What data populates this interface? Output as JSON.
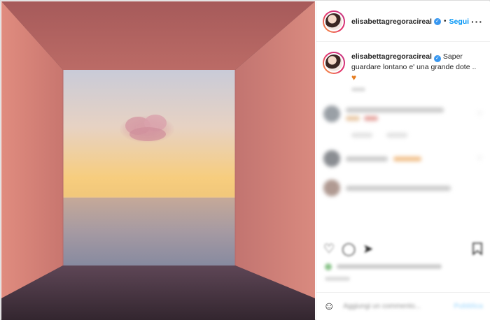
{
  "header": {
    "username": "elisabettagregoracireal",
    "follow_label": "Segui",
    "separator": "•",
    "more_icon": "more-options-icon"
  },
  "caption": {
    "username": "elisabettagregoracireal",
    "text": "Saper guardare lontano e' una grande dote ..",
    "emoji": "♥"
  },
  "actions": {
    "like_icon": "heart-outline-icon",
    "comment_icon": "comment-icon",
    "share_icon": "share-icon",
    "save_icon": "bookmark-icon"
  },
  "add_comment": {
    "placeholder": "Aggiungi un commento...",
    "post_label": "Pubblica",
    "emoji_icon": "smiley-icon"
  },
  "colors": {
    "accent": "#0095f6",
    "verified": "#3897f0",
    "wall": "#c97a72",
    "sky_top": "#c9cbd8",
    "sky_bottom": "#f4c673"
  }
}
